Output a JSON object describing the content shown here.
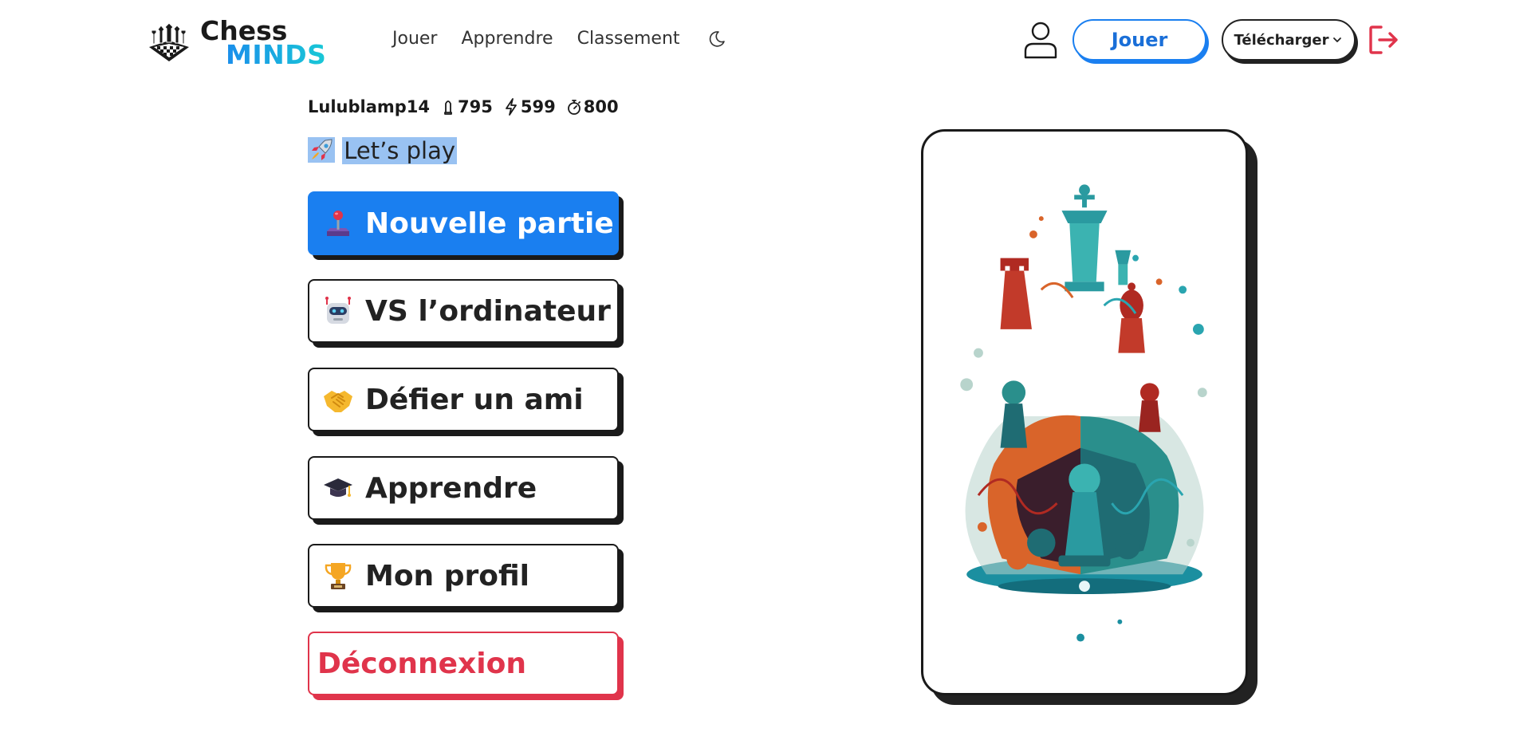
{
  "header": {
    "logo": {
      "line1": "Chess",
      "line2": "MINDS"
    },
    "nav": [
      {
        "label": "Jouer"
      },
      {
        "label": "Apprendre"
      },
      {
        "label": "Classement"
      }
    ],
    "theme_icon": "moon-icon",
    "user_icon": "user-icon",
    "play_button": "Jouer",
    "download_button": "Télécharger",
    "logout_icon": "logout-icon"
  },
  "player": {
    "username": "Lulublamp14",
    "ratings": [
      {
        "icon": "bullet-icon",
        "value": "795"
      },
      {
        "icon": "lightning-icon",
        "value": "599"
      },
      {
        "icon": "stopwatch-icon",
        "value": "800"
      }
    ]
  },
  "main": {
    "heading": "Let’s play",
    "heading_icon": "rocket-icon",
    "menu": [
      {
        "icon": "joystick-icon",
        "label": "Nouvelle partie"
      },
      {
        "icon": "robot-icon",
        "label": "VS l’ordinateur"
      },
      {
        "icon": "handshake-icon",
        "label": "Défier un ami"
      },
      {
        "icon": "graduation-cap-icon",
        "label": "Apprendre"
      },
      {
        "icon": "trophy-icon",
        "label": "Mon profil"
      },
      {
        "icon": "",
        "label": "Déconnexion"
      }
    ]
  },
  "colors": {
    "brand_blue": "#1a7ff0",
    "brand_cyan": "#19c8d6",
    "danger": "#e0344b",
    "ink": "#1a1a1a",
    "selection": "#99c2f2"
  }
}
